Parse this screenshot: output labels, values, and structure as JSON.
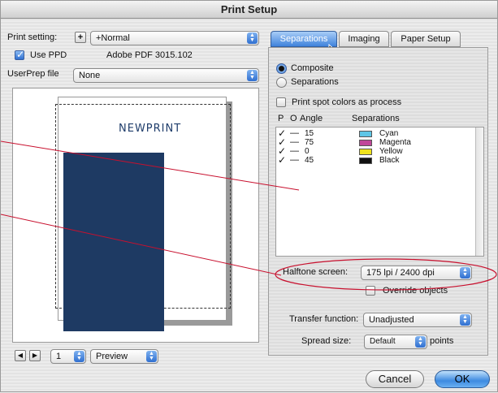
{
  "window": {
    "title": "Print Setup"
  },
  "left": {
    "print_setting_label": "Print setting:",
    "print_setting_value": "+Normal",
    "use_ppd_label": "Use PPD",
    "use_ppd_checked": true,
    "ppd_name": "Adobe PDF 3015.102",
    "userprep_label": "UserPrep file",
    "userprep_value": "None",
    "logo_text": "NEWPRINT",
    "page_number": "1",
    "view_mode": "Preview"
  },
  "tabs": [
    {
      "label": "Separations",
      "active": true
    },
    {
      "label": "Imaging",
      "active": false
    },
    {
      "label": "Paper Setup",
      "active": false
    }
  ],
  "separations": {
    "composite_label": "Composite",
    "separations_label": "Separations",
    "selected_mode": "Composite",
    "spot_as_process_label": "Print spot colors as process",
    "columns": {
      "p": "P",
      "o": "O",
      "angle": "Angle",
      "name": "Separations"
    },
    "rows": [
      {
        "check": "✓",
        "dash": "—",
        "angle": "15",
        "name": "Cyan",
        "color": "#5ec6e6"
      },
      {
        "check": "✓",
        "dash": "—",
        "angle": "75",
        "name": "Magenta",
        "color": "#c0479a"
      },
      {
        "check": "✓",
        "dash": "—",
        "angle": "0",
        "name": "Yellow",
        "color": "#f0e31c"
      },
      {
        "check": "✓",
        "dash": "—",
        "angle": "45",
        "name": "Black",
        "color": "#111111"
      }
    ],
    "halftone_label": "Halftone screen:",
    "halftone_value": "175 lpi / 2400 dpi",
    "override_label": "Override objects",
    "transfer_label": "Transfer function:",
    "transfer_value": "Unadjusted",
    "spread_label": "Spread size:",
    "spread_value": "Default",
    "spread_unit": "points"
  },
  "buttons": {
    "cancel": "Cancel",
    "ok": "OK"
  },
  "colors": {
    "page_block": "#1e3a63",
    "callout": "#c8102e",
    "accent": "#3f83dc"
  }
}
